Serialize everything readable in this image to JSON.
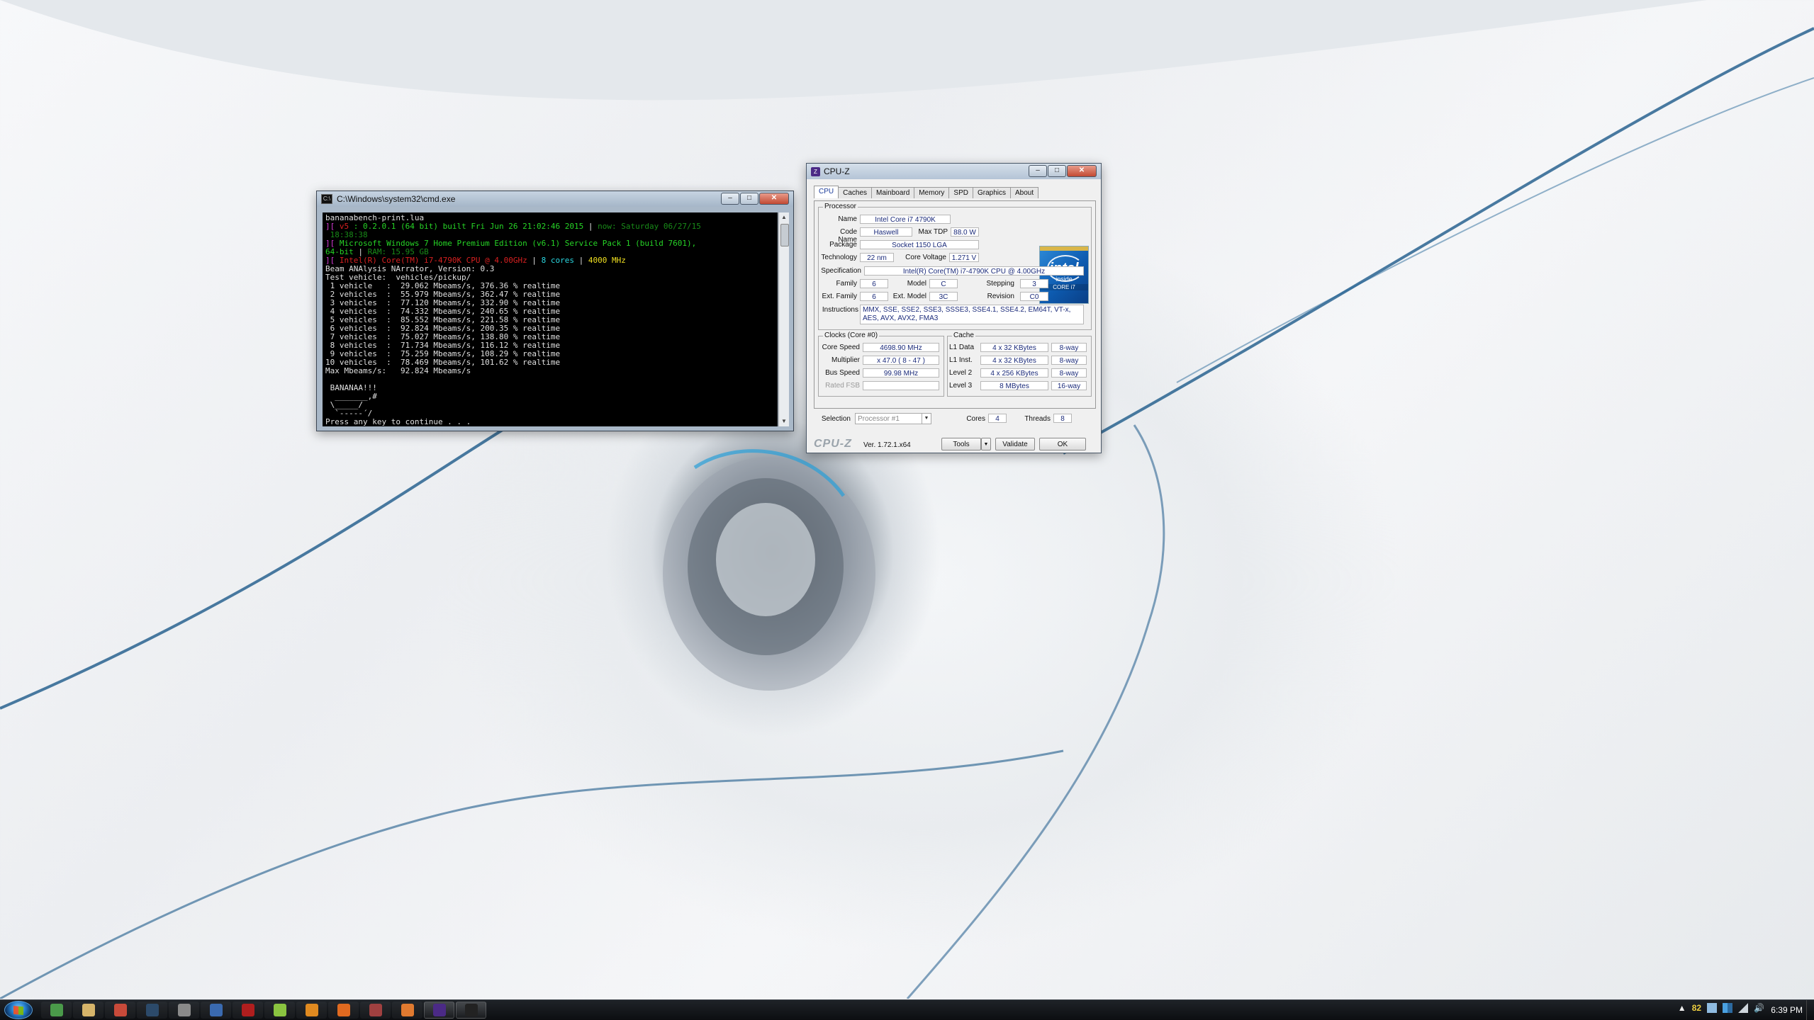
{
  "cmd": {
    "title": "C:\\Windows\\system32\\cmd.exe",
    "lines": [
      [
        {
          "t": "bananabench-print.lua",
          "c": "c-w"
        }
      ],
      [
        {
          "t": "][ ",
          "c": "c-m"
        },
        {
          "t": "v5 ",
          "c": "c-r"
        },
        {
          "t": ": 0.2.0.1 (64 bit) built Fri Jun 26 21:02:46 2015 ",
          "c": "c-g"
        },
        {
          "t": "| ",
          "c": "c-w"
        },
        {
          "t": "now: Saturday 06/27/15",
          "c": "c-dg"
        }
      ],
      [
        {
          "t": " 18:38:38",
          "c": "c-dg"
        }
      ],
      [
        {
          "t": "][ ",
          "c": "c-m"
        },
        {
          "t": "Microsoft Windows 7 Home Premium Edition (v6.1) Service Pack 1 (build 7601),",
          "c": "c-g"
        }
      ],
      [
        {
          "t": "64-bit ",
          "c": "c-g"
        },
        {
          "t": "| ",
          "c": "c-w"
        },
        {
          "t": "RAM: 15.95 GB",
          "c": "c-dg"
        }
      ],
      [
        {
          "t": "][ ",
          "c": "c-m"
        },
        {
          "t": "Intel(R) Core(TM) i7-4790K CPU @ 4.00GHz ",
          "c": "c-r"
        },
        {
          "t": "| ",
          "c": "c-w"
        },
        {
          "t": "8 cores ",
          "c": "c-c"
        },
        {
          "t": "| ",
          "c": "c-w"
        },
        {
          "t": "4000 MHz",
          "c": "c-y"
        }
      ],
      [
        {
          "t": "Beam ANAlysis NArrator, Version: 0.3",
          "c": "c-w"
        }
      ],
      [
        {
          "t": "Test vehicle:  vehicles/pickup/",
          "c": "c-w"
        }
      ],
      [
        {
          "t": " 1 vehicle   :  29.062 Mbeams/s, 376.36 % realtime",
          "c": "c-w"
        }
      ],
      [
        {
          "t": " 2 vehicles  :  55.979 Mbeams/s, 362.47 % realtime",
          "c": "c-w"
        }
      ],
      [
        {
          "t": " 3 vehicles  :  77.120 Mbeams/s, 332.90 % realtime",
          "c": "c-w"
        }
      ],
      [
        {
          "t": " 4 vehicles  :  74.332 Mbeams/s, 240.65 % realtime",
          "c": "c-w"
        }
      ],
      [
        {
          "t": " 5 vehicles  :  85.552 Mbeams/s, 221.58 % realtime",
          "c": "c-w"
        }
      ],
      [
        {
          "t": " 6 vehicles  :  92.824 Mbeams/s, 200.35 % realtime",
          "c": "c-w"
        }
      ],
      [
        {
          "t": " 7 vehicles  :  75.027 Mbeams/s, 138.80 % realtime",
          "c": "c-w"
        }
      ],
      [
        {
          "t": " 8 vehicles  :  71.734 Mbeams/s, 116.12 % realtime",
          "c": "c-w"
        }
      ],
      [
        {
          "t": " 9 vehicles  :  75.259 Mbeams/s, 108.29 % realtime",
          "c": "c-w"
        }
      ],
      [
        {
          "t": "10 vehicles  :  78.469 Mbeams/s, 101.62 % realtime",
          "c": "c-w"
        }
      ],
      [
        {
          "t": "Max Mbeams/s:   92.824 Mbeams/s",
          "c": "c-w"
        }
      ],
      [
        {
          "t": " ",
          "c": "c-w"
        }
      ],
      [
        {
          "t": " BANANAA!!!",
          "c": "c-w"
        }
      ],
      [
        {
          "t": "  _______,#",
          "c": "c-w"
        }
      ],
      [
        {
          "t": " \\_____/  ",
          "c": "c-w"
        }
      ],
      [
        {
          "t": "  `-----´/ ",
          "c": "c-w"
        }
      ],
      [
        {
          "t": "Press any key to continue . . .",
          "c": "c-w"
        }
      ]
    ]
  },
  "cpuz": {
    "title": "CPU-Z",
    "tabs": [
      "CPU",
      "Caches",
      "Mainboard",
      "Memory",
      "SPD",
      "Graphics",
      "About"
    ],
    "processor": {
      "legend": "Processor",
      "name_label": "Name",
      "name": "Intel Core i7 4790K",
      "codename_label": "Code Name",
      "codename": "Haswell",
      "maxtdp_label": "Max TDP",
      "maxtdp": "88.0 W",
      "package_label": "Package",
      "package": "Socket 1150 LGA",
      "technology_label": "Technology",
      "technology": "22 nm",
      "corevoltage_label": "Core Voltage",
      "corevoltage": "1.271 V",
      "specification_label": "Specification",
      "specification": "Intel(R) Core(TM) i7-4790K CPU @ 4.00GHz",
      "family_label": "Family",
      "family": "6",
      "model_label": "Model",
      "model": "C",
      "stepping_label": "Stepping",
      "stepping": "3",
      "extfamily_label": "Ext. Family",
      "extfamily": "6",
      "extmodel_label": "Ext. Model",
      "extmodel": "3C",
      "revision_label": "Revision",
      "revision": "C0",
      "instructions_label": "Instructions",
      "instructions": "MMX, SSE, SSE2, SSE3, SSSE3, SSE4.1, SSE4.2, EM64T, VT-x, AES, AVX, AVX2, FMA3"
    },
    "intel_logo": {
      "brand": "intel",
      "inside": "inside",
      "line": "CORE i7"
    },
    "clocks": {
      "legend": "Clocks (Core #0)",
      "corespeed_label": "Core Speed",
      "corespeed": "4698.90 MHz",
      "multiplier_label": "Multiplier",
      "multiplier": "x 47.0 ( 8 - 47 )",
      "busspeed_label": "Bus Speed",
      "busspeed": "99.98 MHz",
      "ratedfsb_label": "Rated FSB",
      "ratedfsb": ""
    },
    "cache": {
      "legend": "Cache",
      "rows": [
        {
          "label": "L1 Data",
          "size": "4 x 32 KBytes",
          "way": "8-way"
        },
        {
          "label": "L1 Inst.",
          "size": "4 x 32 KBytes",
          "way": "8-way"
        },
        {
          "label": "Level 2",
          "size": "4 x 256 KBytes",
          "way": "8-way"
        },
        {
          "label": "Level 3",
          "size": "8 MBytes",
          "way": "16-way"
        }
      ]
    },
    "selection_label": "Selection",
    "selection": "Processor #1",
    "cores_label": "Cores",
    "cores": "4",
    "threads_label": "Threads",
    "threads": "8",
    "brand": "CPU-Z",
    "version": "Ver. 1.72.1.x64",
    "tools_label": "Tools",
    "validate_label": "Validate",
    "ok_label": "OK"
  },
  "taskbar": {
    "tray_number": "82",
    "clock": "6:39 PM",
    "apps": [
      {
        "name": "chrome",
        "color": "#4a9a4a",
        "open": false
      },
      {
        "name": "explorer",
        "color": "#d6b46a",
        "open": false
      },
      {
        "name": "app-red",
        "color": "#c84a3a",
        "open": false
      },
      {
        "name": "steam",
        "color": "#2c4a6a",
        "open": false
      },
      {
        "name": "app-gray",
        "color": "#8a8a8a",
        "open": false
      },
      {
        "name": "app-blue",
        "color": "#3a6ab0",
        "open": false
      },
      {
        "name": "acrobat",
        "color": "#b01e1e",
        "open": false
      },
      {
        "name": "android",
        "color": "#8ac440",
        "open": false
      },
      {
        "name": "headphones",
        "color": "#e08a20",
        "open": false
      },
      {
        "name": "firefox",
        "color": "#e06a20",
        "open": false
      },
      {
        "name": "app-flag",
        "color": "#a04040",
        "open": false
      },
      {
        "name": "app-orange",
        "color": "#e07a30",
        "open": false
      },
      {
        "name": "cpuz",
        "color": "#4b2a86",
        "open": true
      },
      {
        "name": "cmd",
        "color": "#222",
        "open": true
      }
    ]
  }
}
